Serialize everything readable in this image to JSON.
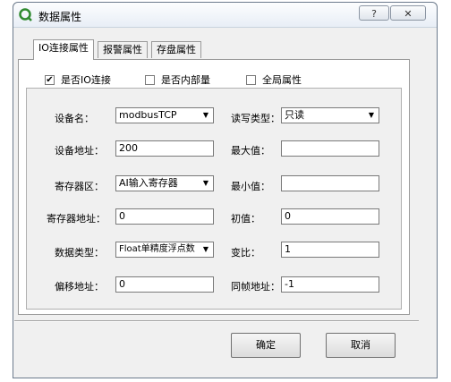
{
  "window": {
    "title": "数据属性",
    "help_button": "?",
    "close_button": "✕"
  },
  "tabs": [
    {
      "label": "IO连接属性"
    },
    {
      "label": "报警属性"
    },
    {
      "label": "存盘属性"
    }
  ],
  "checkboxes": [
    {
      "label": "是否IO连接",
      "checked": true,
      "mark": "✔"
    },
    {
      "label": "是否内部量",
      "checked": false,
      "mark": ""
    },
    {
      "label": "全局属性",
      "checked": false,
      "mark": ""
    }
  ],
  "form": {
    "device_name": {
      "label": "设备名：",
      "value": "modbusTCP"
    },
    "rw_type": {
      "label": "读写类型：",
      "value": "只读"
    },
    "device_address": {
      "label": "设备地址：",
      "value": "200"
    },
    "max_value": {
      "label": "最大值：",
      "value": ""
    },
    "register_area": {
      "label": "寄存器区：",
      "value": "AI输入寄存器"
    },
    "min_value": {
      "label": "最小值：",
      "value": ""
    },
    "register_address": {
      "label": "寄存器地址：",
      "value": "0"
    },
    "initial_value": {
      "label": "初值：",
      "value": "0"
    },
    "data_type": {
      "label": "数据类型：",
      "value": "Float单精度浮点数"
    },
    "ratio": {
      "label": "变比：",
      "value": "1"
    },
    "offset_address": {
      "label": "偏移地址：",
      "value": "0"
    },
    "sync_frame_address": {
      "label": "同帧地址：",
      "value": "-1"
    }
  },
  "buttons": {
    "ok": "确定",
    "cancel": "取消"
  }
}
